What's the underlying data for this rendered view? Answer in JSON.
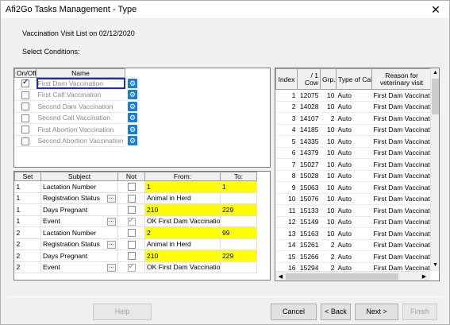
{
  "window": {
    "title": "Afi2Go Tasks Management - Type",
    "close_glyph": "✕"
  },
  "header": {
    "visit_list_label": "Vaccination Visit List on 02/12/2020",
    "select_conditions_label": "Select Conditions:"
  },
  "conditions": {
    "headers": {
      "on_off": "On/Off",
      "name": "Name"
    },
    "rows": [
      {
        "checked": true,
        "name": "First Dam Vaccination"
      },
      {
        "checked": false,
        "name": "First Calf Vaccination"
      },
      {
        "checked": false,
        "name": "Second Dam Vaccination"
      },
      {
        "checked": false,
        "name": "Second Call Vaccination"
      },
      {
        "checked": false,
        "name": "First Abortion Vaccination"
      },
      {
        "checked": false,
        "name": "Second Abortion Vaccination"
      }
    ]
  },
  "subjects": {
    "headers": {
      "set": "Set",
      "subject": "Subject",
      "not": "Not",
      "from": "From:",
      "to": "To:"
    },
    "rows": [
      {
        "set": "1",
        "subject": "Lactation Number",
        "has_dots": false,
        "not_checked": false,
        "not_disabled": false,
        "from": "1",
        "to": "1",
        "highlight": true
      },
      {
        "set": "1",
        "subject": "Registration Status",
        "has_dots": true,
        "not_checked": false,
        "not_disabled": false,
        "from": "Animal in Herd",
        "to": "",
        "highlight": false
      },
      {
        "set": "1",
        "subject": "Days Pregnant",
        "has_dots": false,
        "not_checked": false,
        "not_disabled": false,
        "from": "210",
        "to": "229",
        "highlight": true
      },
      {
        "set": "1",
        "subject": "Event",
        "has_dots": true,
        "not_checked": true,
        "not_disabled": true,
        "from": "OK First Dam Vaccination",
        "to": "",
        "highlight": false
      },
      {
        "set": "2",
        "subject": "Lactation Number",
        "has_dots": false,
        "not_checked": false,
        "not_disabled": false,
        "from": "2",
        "to": "99",
        "highlight": true
      },
      {
        "set": "2",
        "subject": "Registration Status",
        "has_dots": true,
        "not_checked": false,
        "not_disabled": false,
        "from": "Animal in Herd",
        "to": "",
        "highlight": false
      },
      {
        "set": "2",
        "subject": "Days Pregnant",
        "has_dots": false,
        "not_checked": false,
        "not_disabled": false,
        "from": "210",
        "to": "229",
        "highlight": true
      },
      {
        "set": "2",
        "subject": "Event",
        "has_dots": true,
        "not_checked": true,
        "not_disabled": true,
        "from": "OK First Dam Vaccination",
        "to": "",
        "highlight": false
      }
    ]
  },
  "visits": {
    "headers": {
      "index": "Index",
      "cow_top": "/ 1",
      "cow": "Cow",
      "grp": "Grp.",
      "type": "Type of Call",
      "reason": "Reason for veterinary visit"
    },
    "rows": [
      {
        "index": "1",
        "cow": "12075",
        "grp": "10",
        "type": "Auto",
        "reason": "First Dam Vaccination"
      },
      {
        "index": "2",
        "cow": "14028",
        "grp": "10",
        "type": "Auto",
        "reason": "First Dam Vaccination"
      },
      {
        "index": "3",
        "cow": "14107",
        "grp": "2",
        "type": "Auto",
        "reason": "First Dam Vaccination"
      },
      {
        "index": "4",
        "cow": "14185",
        "grp": "10",
        "type": "Auto",
        "reason": "First Dam Vaccination"
      },
      {
        "index": "5",
        "cow": "14335",
        "grp": "10",
        "type": "Auto",
        "reason": "First Dam Vaccination"
      },
      {
        "index": "6",
        "cow": "14379",
        "grp": "10",
        "type": "Auto",
        "reason": "First Dam Vaccination"
      },
      {
        "index": "7",
        "cow": "15027",
        "grp": "10",
        "type": "Auto",
        "reason": "First Dam Vaccination"
      },
      {
        "index": "8",
        "cow": "15028",
        "grp": "10",
        "type": "Auto",
        "reason": "First Dam Vaccination"
      },
      {
        "index": "9",
        "cow": "15063",
        "grp": "10",
        "type": "Auto",
        "reason": "First Dam Vaccination"
      },
      {
        "index": "10",
        "cow": "15076",
        "grp": "10",
        "type": "Auto",
        "reason": "First Dam Vaccination"
      },
      {
        "index": "11",
        "cow": "15133",
        "grp": "10",
        "type": "Auto",
        "reason": "First Dam Vaccination"
      },
      {
        "index": "12",
        "cow": "15149",
        "grp": "10",
        "type": "Auto",
        "reason": "First Dam Vaccination"
      },
      {
        "index": "13",
        "cow": "15163",
        "grp": "10",
        "type": "Auto",
        "reason": "First Dam Vaccination"
      },
      {
        "index": "14",
        "cow": "15261",
        "grp": "2",
        "type": "Auto",
        "reason": "First Dam Vaccination"
      },
      {
        "index": "15",
        "cow": "15266",
        "grp": "2",
        "type": "Auto",
        "reason": "First Dam Vaccination"
      },
      {
        "index": "16",
        "cow": "15294",
        "grp": "2",
        "type": "Auto",
        "reason": "First Dam Vaccination"
      }
    ]
  },
  "buttons": {
    "help": "Help",
    "cancel": "Cancel",
    "back": "< Back",
    "next": "Next >",
    "finish": "Finish"
  },
  "icons": {
    "gear": "⚙",
    "dots": "...",
    "scroll_up": "▲",
    "scroll_down": "▼",
    "scroll_left": "◀",
    "scroll_right": "▶"
  }
}
